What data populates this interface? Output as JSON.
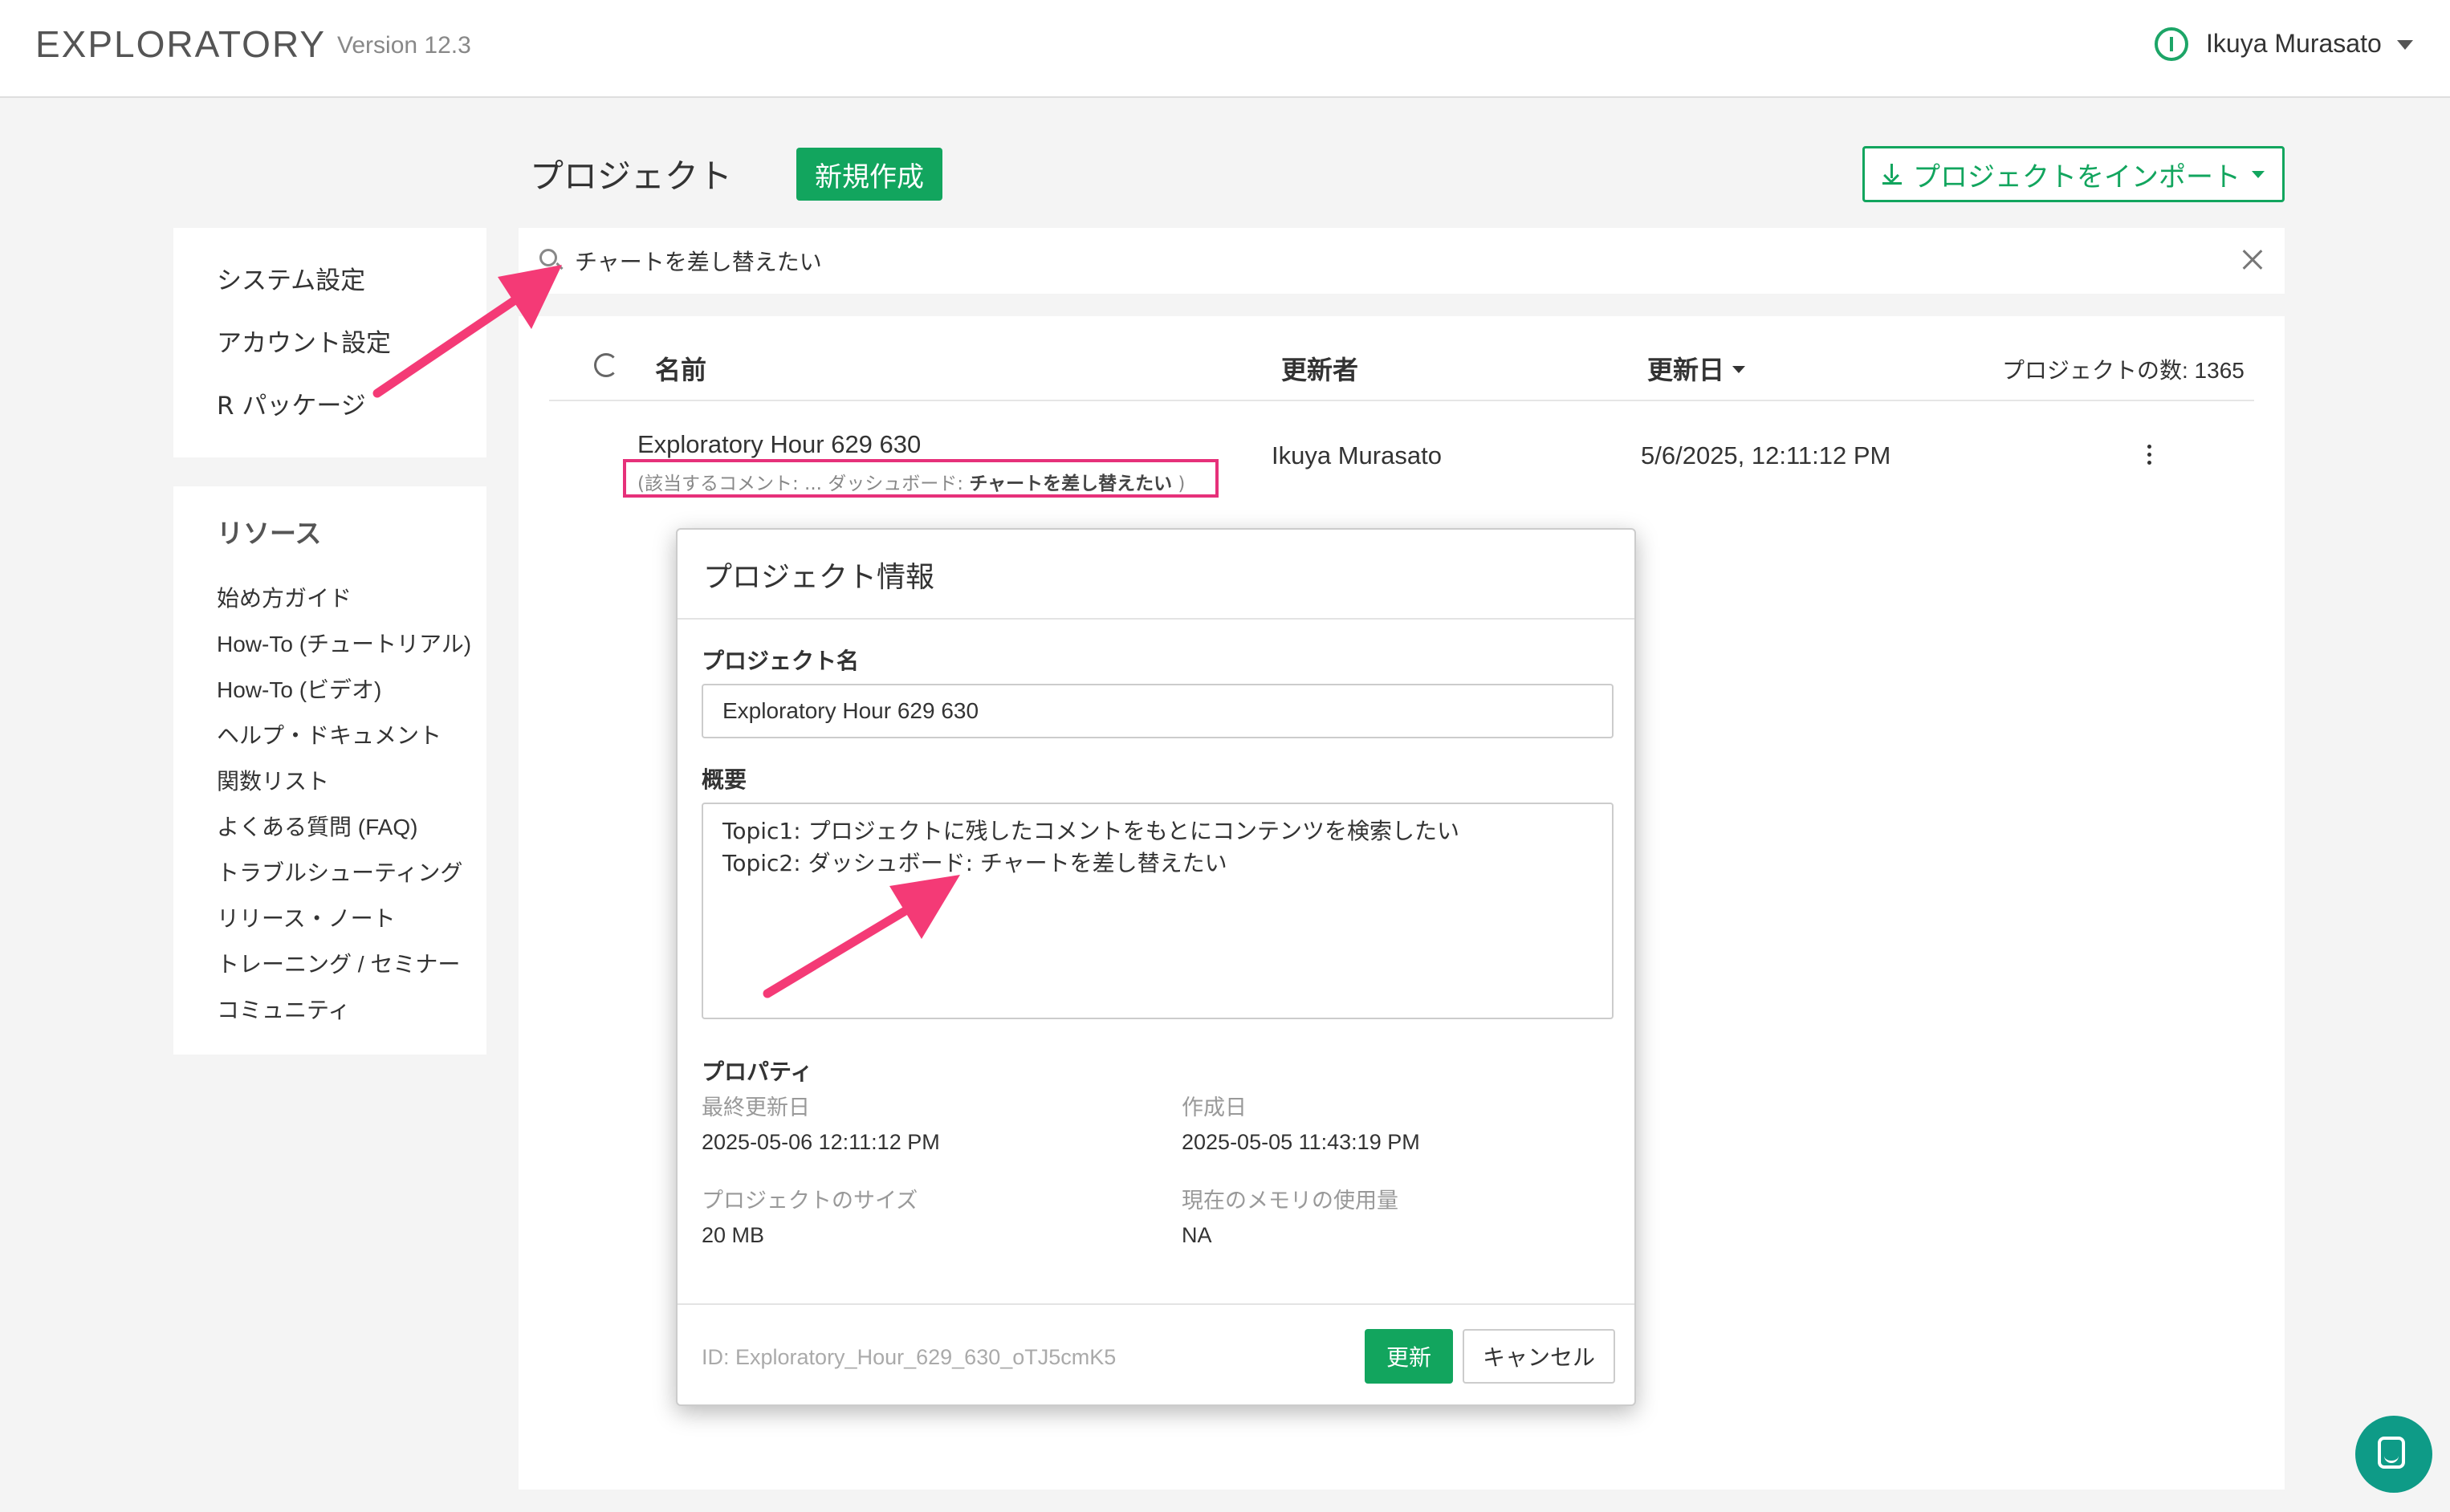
{
  "app": {
    "logo": "EXPLORATORY",
    "version": "Version 12.3"
  },
  "user": {
    "name": "Ikuya Murasato"
  },
  "header": {
    "title": "プロジェクト",
    "new_button": "新規作成",
    "import_button": "プロジェクトをインポート"
  },
  "sidebar": {
    "settings": [
      "システム設定",
      "アカウント設定",
      "R パッケージ"
    ],
    "resources_title": "リソース",
    "resources": [
      "始め方ガイド",
      "How-To (チュートリアル)",
      "How-To (ビデオ)",
      "ヘルプ・ドキュメント",
      "関数リスト",
      "よくある質問 (FAQ)",
      "トラブルシューティング",
      "リリース・ノート",
      "トレーニング / セミナー",
      "コミュニティ"
    ]
  },
  "search": {
    "value": "チャートを差し替えたい"
  },
  "list": {
    "col_name": "名前",
    "col_author": "更新者",
    "col_date": "更新日",
    "count_label": "プロジェクトの数: 1365",
    "rows": [
      {
        "name": "Exploratory Hour 629 630",
        "comment_prefix": "(該当するコメント: ... ダッシュボード: ",
        "comment_match": "チャートを差し替えたい",
        "comment_suffix": " )",
        "author": "Ikuya Murasato",
        "date": "5/6/2025, 12:11:12 PM"
      }
    ]
  },
  "modal": {
    "title": "プロジェクト情報",
    "name_label": "プロジェクト名",
    "name_value": "Exploratory Hour 629 630",
    "desc_label": "概要",
    "desc_value": "Topic1: プロジェクトに残したコメントをもとにコンテンツを検索したい\nTopic2: ダッシュボード: チャートを差し替えたい",
    "props_label": "プロパティ",
    "updated_label": "最終更新日",
    "updated_value": "2025-05-06 12:11:12 PM",
    "created_label": "作成日",
    "created_value": "2025-05-05 11:43:19 PM",
    "size_label": "プロジェクトのサイズ",
    "size_value": "20 MB",
    "memory_label": "現在のメモリの使用量",
    "memory_value": "NA",
    "id_text": "ID: Exploratory_Hour_629_630_oTJ5cmK5",
    "update_button": "更新",
    "cancel_button": "キャンセル"
  },
  "colors": {
    "accent": "#12a55e",
    "highlight": "#e6317a",
    "chat": "#0e9b87"
  }
}
